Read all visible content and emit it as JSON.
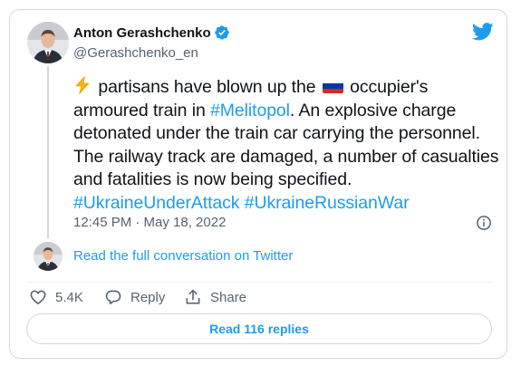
{
  "author": {
    "name": "Anton Gerashchenko",
    "handle": "@Gerashchenko_en",
    "verified": true
  },
  "tweet": {
    "emoji_icon": "high-voltage-icon",
    "part1": "partisans have blown up the",
    "flag_icon": "russia-flag-icon",
    "part2": "occupier's armoured train in",
    "hashtag_melitopol": "#Melitopol",
    "part3": ". An explosive charge detonated under the train car carrying the personnel. The railway track are damaged, a number of casualties and fatalities is now being specified.",
    "hashtag_ukraine_under_attack": "#UkraineUnderAttack",
    "hashtag_ukraine_russian_war": "#UkraineRussianWar",
    "timestamp": "12:45 PM · May 18, 2022"
  },
  "conversation": {
    "link_text": "Read the full conversation on Twitter"
  },
  "actions": {
    "like_count": "5.4K",
    "reply_label": "Reply",
    "share_label": "Share"
  },
  "footer": {
    "read_replies_label": "Read 116 replies"
  },
  "colors": {
    "accent": "#1d9bf0",
    "text": "#0f1419",
    "secondary": "#536471",
    "border": "#cfd9de"
  }
}
